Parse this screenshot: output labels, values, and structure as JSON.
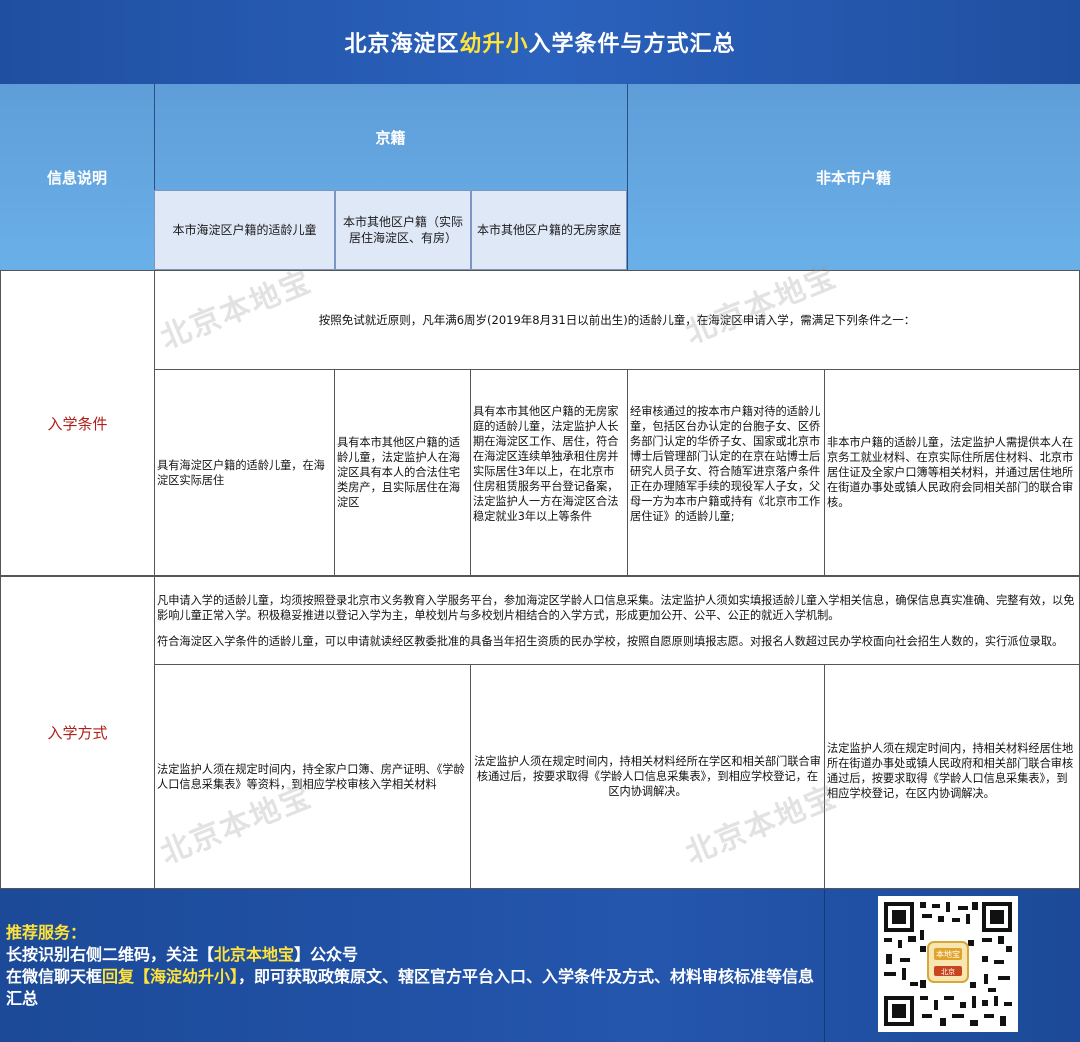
{
  "title": {
    "prefix": "北京海淀区",
    "highlight": "幼升小",
    "suffix": "入学条件与方式汇总"
  },
  "header": {
    "info_label": "信息说明",
    "beijing_label": "京籍",
    "non_local_label": "非本市户籍",
    "sub": [
      "本市海淀区户籍的适龄儿童",
      "本市其他区户籍（实际居住海淀区、有房）",
      "本市其他区户籍的无房家庭"
    ]
  },
  "watermark": "北京本地宝",
  "admission_conditions": {
    "label": "入学条件",
    "intro": "按照免试就近原则，凡年满6周岁(2019年8月31日以前出生)的适龄儿童，在海淀区申请入学，需满足下列条件之一：",
    "cells": [
      "具有海淀区户籍的适龄儿童，在海淀区实际居住",
      "具有本市其他区户籍的适龄儿童，法定监护人在海淀区具有本人的合法住宅类房产，且实际居住在海淀区",
      "具有本市其他区户籍的无房家庭的适龄儿童，法定监护人长期在海淀区工作、居住，符合在海淀区连续单独承租住房并实际居住3年以上，在北京市住房租赁服务平台登记备案，法定监护人一方在海淀区合法稳定就业3年以上等条件",
      "经审核通过的按本市户籍对待的适龄儿童，包括区台办认定的台胞子女、区侨务部门认定的华侨子女、国家或北京市博士后管理部门认定的在京在站博士后研究人员子女、符合随军进京落户条件正在办理随军手续的现役军人子女，父母一方为本市户籍或持有《北京市工作居住证》的适龄儿童;",
      "非本市户籍的适龄儿童，法定监护人需提供本人在京务工就业材料、在京实际住所居住材料、北京市居住证及全家户口簿等相关材料，并通过居住地所在街道办事处或镇人民政府会同相关部门的联合审核。"
    ]
  },
  "admission_methods": {
    "label": "入学方式",
    "para1": "凡申请入学的适龄儿童，均须按照登录北京市义务教育入学服务平台，参加海淀区学龄人口信息采集。法定监护人须如实填报适龄儿童入学相关信息，确保信息真实准确、完整有效，以免影响儿童正常入学。积极稳妥推进以登记入学为主，单校划片与多校划片相结合的入学方式，形成更加公开、公平、公正的就近入学机制。",
    "para2": "符合海淀区入学条件的适龄儿童，可以申请就读经区教委批准的具备当年招生资质的民办学校，按照自愿原则填报志愿。对报名人数超过民办学校面向社会招生人数的，实行派位录取。",
    "cells": [
      "法定监护人须在规定时间内，持全家户口簿、房产证明、《学龄人口信息采集表》等资料，到相应学校审核入学相关材料",
      "法定监护人须在规定时间内，持相关材料经所在学区和相关部门联合审核通过后，按要求取得《学龄人口信息采集表》，到相应学校登记，在区内协调解决。",
      "法定监护人须在规定时间内，持相关材料经居住地所在街道办事处或镇人民政府和相关部门联合审核通过后，按要求取得《学龄人口信息采集表》，到相应学校登记，在区内协调解决。"
    ]
  },
  "footer": {
    "heading": "推荐服务：",
    "line1_a": "长按识别右侧二维码，关注【",
    "line1_b": "北京本地宝",
    "line1_c": "】公众号",
    "line2_a": "在微信聊天框",
    "line2_b": "回复【海淀幼升小】",
    "line2_c": "，即可获取政策原文、辖区官方平台入口、入学条件及方式、材料审核标准等信息汇总"
  },
  "qr": {
    "badge_top": "本地宝",
    "badge_bottom": "北京"
  },
  "colors": {
    "title_bg": "#2456ae",
    "header_bg": "#6ab0e8",
    "highlight": "#ffe23a",
    "side_label": "#b0201a"
  }
}
